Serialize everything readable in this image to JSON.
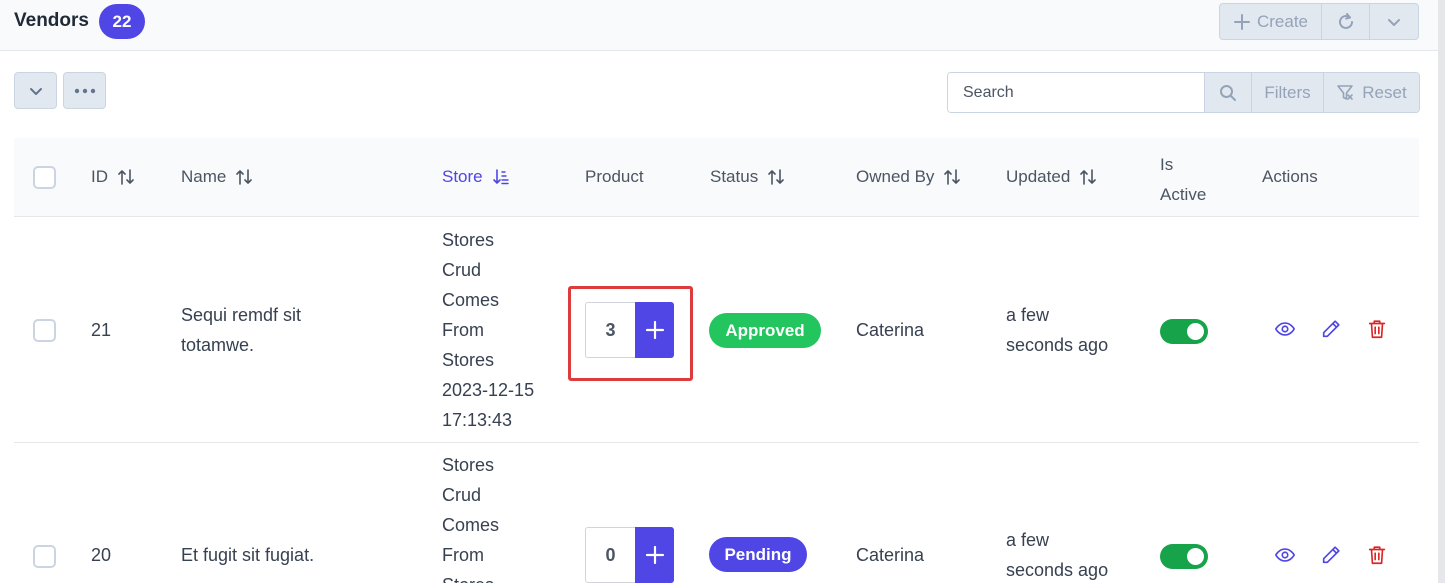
{
  "header": {
    "title": "Vendors",
    "count": "22",
    "create_label": "Create"
  },
  "toolbar": {
    "search_placeholder": "Search",
    "filters_label": "Filters",
    "reset_label": "Reset"
  },
  "table": {
    "columns": {
      "id": "ID",
      "name": "Name",
      "store": "Store",
      "product": "Product",
      "status": "Status",
      "owned_by": "Owned By",
      "updated": "Updated",
      "is_active": "Is Active",
      "actions": "Actions"
    },
    "rows": [
      {
        "id": "21",
        "name_line1": "Sequi remdf sit",
        "name_line2": "totamwe.",
        "store_lines": [
          "Stores",
          "Crud",
          "Comes",
          "From",
          "Stores",
          "2023-12-15",
          "17:13:43"
        ],
        "product_count": "3",
        "status": "Approved",
        "owned_by": "Caterina",
        "updated_line1": "a few",
        "updated_line2": "seconds ago",
        "is_active": true
      },
      {
        "id": "20",
        "name_line1": "Et fugit sit fugiat.",
        "store_lines": [
          "Stores",
          "Crud",
          "Comes",
          "From",
          "Stores"
        ],
        "product_count": "0",
        "status": "Pending",
        "owned_by": "Caterina",
        "updated_line1": "a few",
        "updated_line2": "seconds ago",
        "is_active": true
      }
    ]
  },
  "colors": {
    "primary": "#4f46e5",
    "approved": "#22c55e",
    "toggle_on": "#16a34a",
    "delete": "#dc2626",
    "highlight": "#dc3c3c"
  }
}
